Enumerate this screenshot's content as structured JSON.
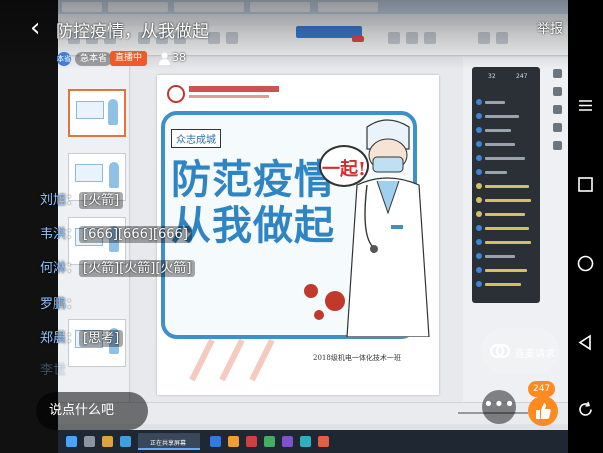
{
  "stream": {
    "title": "防控疫情，从我做起",
    "back_glyph": "‹",
    "report_label": "举报",
    "host_avatar_text": "本省",
    "host_name": "急本省",
    "live_badge": "直播中",
    "viewer_count": "38"
  },
  "comments": [
    {
      "name": "刘旭",
      "sep": "：",
      "msg": "[火箭]"
    },
    {
      "name": "韦洪",
      "sep": "：",
      "msg": "[666][666][666]"
    },
    {
      "name": "何淋",
      "sep": "：",
      "msg": "[火箭][火箭][火箭]"
    },
    {
      "name": "罗鹏",
      "sep": "：",
      "msg": ""
    },
    {
      "name": "郑晨",
      "sep": "：",
      "msg": "[思考]"
    },
    {
      "name": "李世",
      "sep": "",
      "msg": ""
    }
  ],
  "composer": {
    "placeholder": "说点什么吧"
  },
  "actions": {
    "mic_request_label": "连麦请求",
    "more_glyph": "•••",
    "like_count": "247"
  },
  "slide": {
    "tag": "众志成城",
    "bubble_text": "一起!",
    "title_line1": "防范疫情",
    "title_line2": "从我做起",
    "footer": "2018级机电一体化技术一班"
  },
  "chat_panel": {
    "stat_left": "32",
    "stat_right": "247"
  },
  "taskbar": {
    "active_app": "正在共享屏幕",
    "clock_time": "",
    "clock_date": ""
  },
  "colors": {
    "live_badge": "#f05a28",
    "comment_name": "#8fc4ff",
    "slide_title": "#2f84c4",
    "like": "#ff8a1f"
  },
  "icons": {
    "back": "chevron-left-icon",
    "viewer": "person-icon",
    "mic": "link-icon",
    "like": "thumbs-up-icon",
    "nav": [
      "square-icon",
      "circle-icon",
      "triangle-back-icon"
    ]
  }
}
